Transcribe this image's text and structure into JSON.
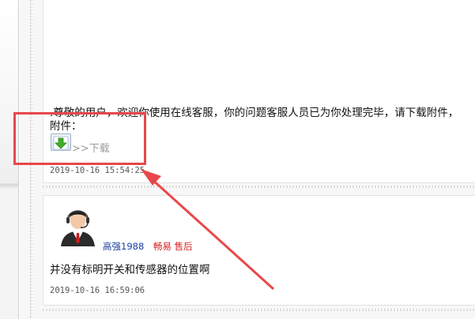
{
  "messages": [
    {
      "text_line1": ".尊敬的用户，欢迎你使用在线客服，你的问题客服人员已为你处理完毕，请下载附件，",
      "text_line2": "附件：",
      "attachment": {
        "icon": "download-arrow-icon",
        "link_label": ">>下载"
      },
      "timestamp": "2019-10-16 15:54:25"
    },
    {
      "author": {
        "avatar": "customer-service-agent-avatar",
        "name": "高强1988",
        "role": "畅易 售后"
      },
      "text": "并没有标明开关和传感器的位置啊",
      "timestamp": "2019-10-16 16:59:06"
    }
  ],
  "annotation": {
    "box_color": "#e8474a",
    "arrow_color": "#e8474a"
  },
  "colors": {
    "username": "#1a3fa0",
    "role": "#d11a1a",
    "download_link": "#9a9a9a"
  }
}
